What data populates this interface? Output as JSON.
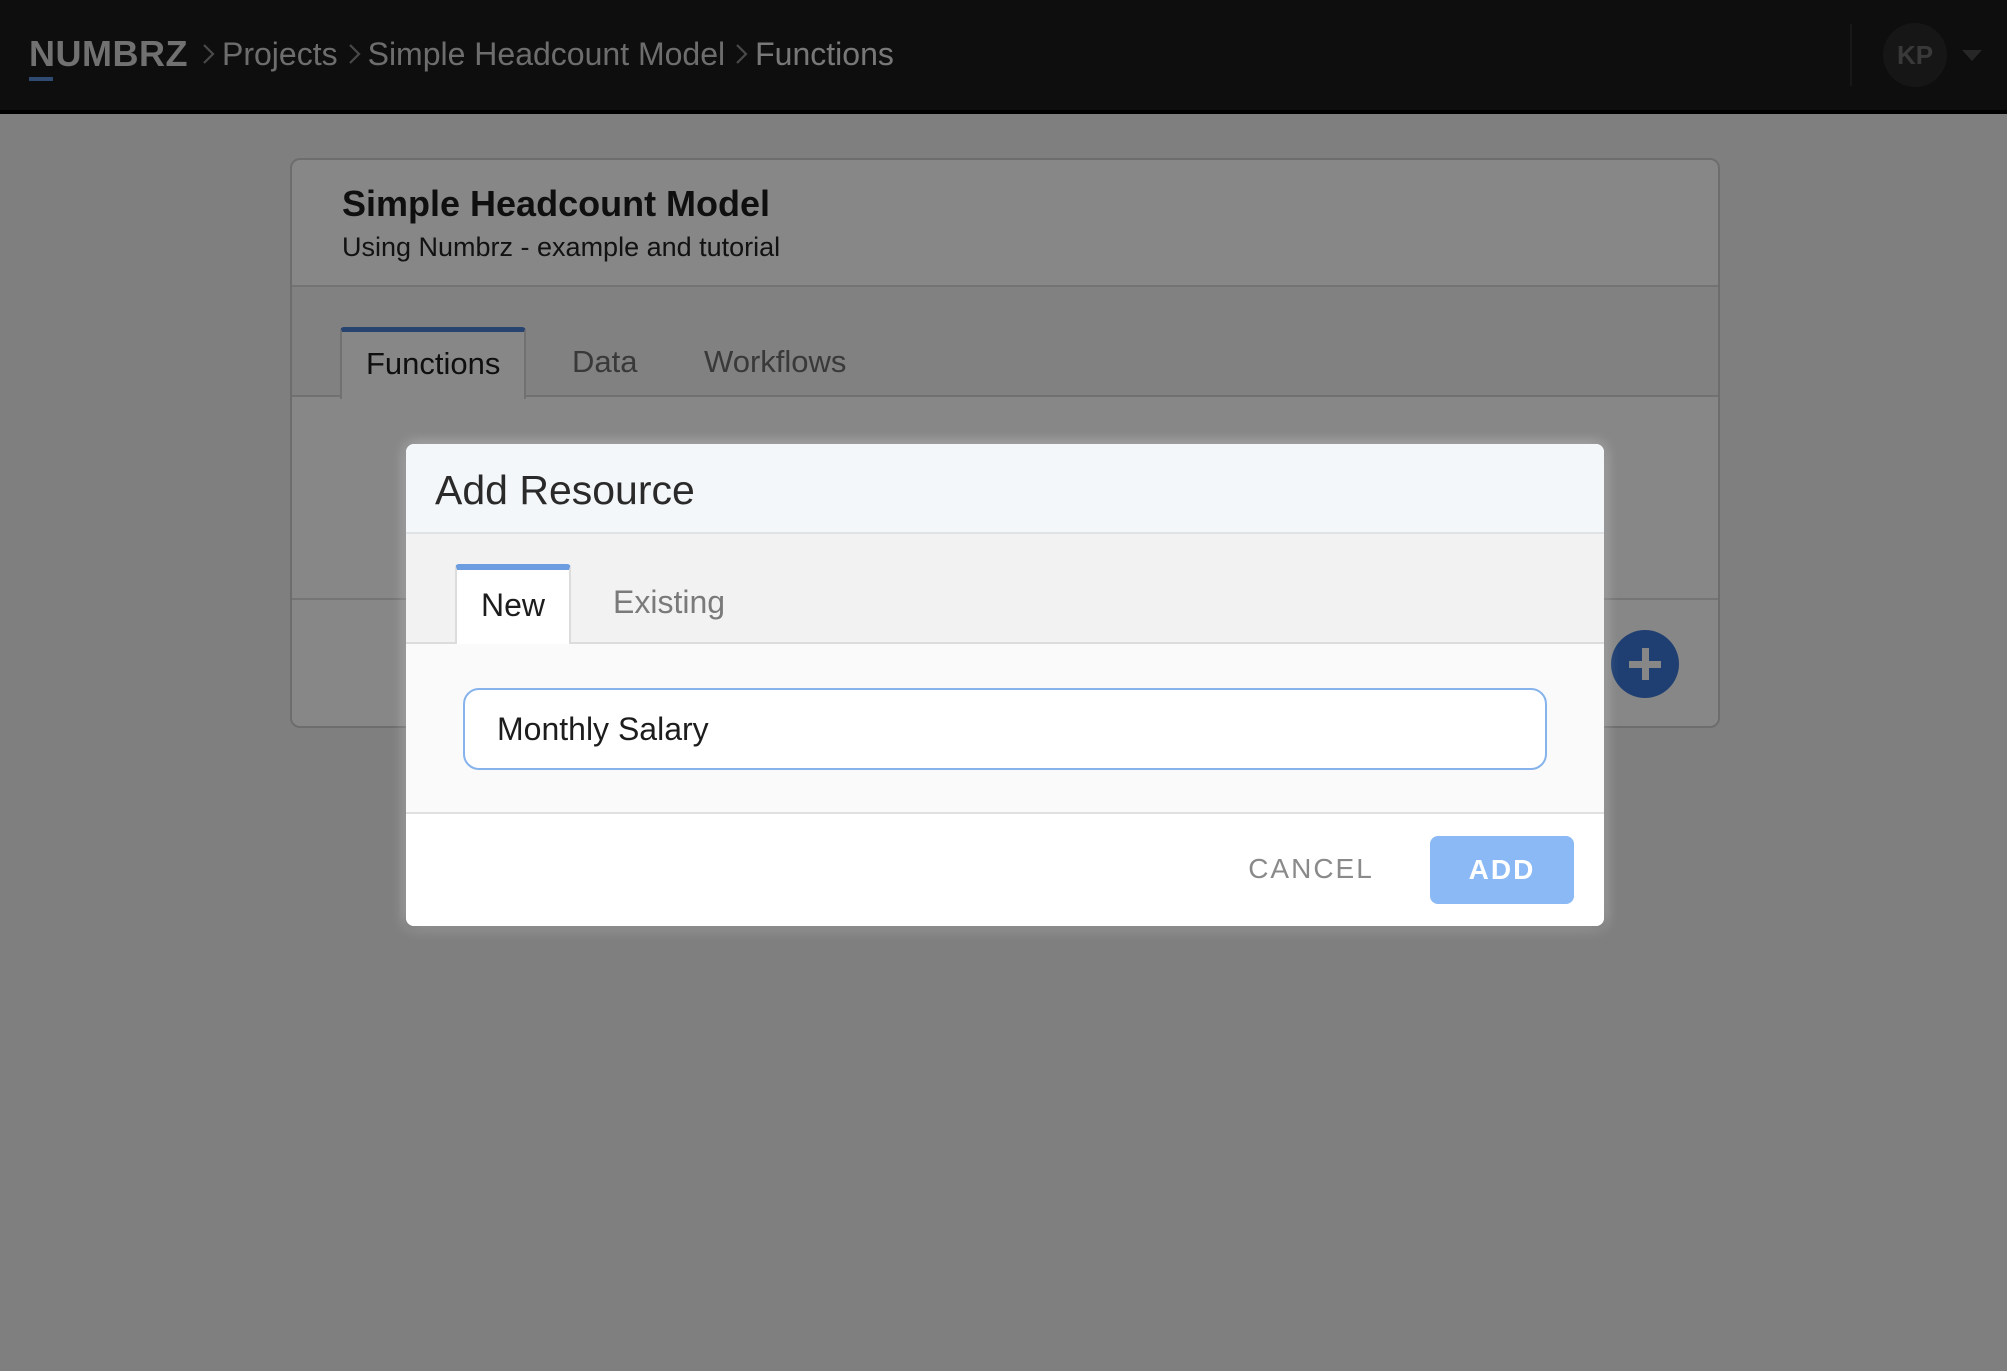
{
  "app": {
    "brand": "NUMBRZ",
    "brand_accent_color": "#5b8fd6"
  },
  "breadcrumb": [
    {
      "label": "Projects"
    },
    {
      "label": "Simple Headcount Model"
    },
    {
      "label": "Functions"
    }
  ],
  "user": {
    "initials": "KP"
  },
  "project": {
    "title": "Simple Headcount Model",
    "subtitle": "Using Numbrz - example and tutorial",
    "tabs": [
      {
        "label": "Functions",
        "active": true
      },
      {
        "label": "Data",
        "active": false
      },
      {
        "label": "Workflows",
        "active": false
      }
    ],
    "add_button_icon": "plus-icon",
    "accent_color": "#3b78d8"
  },
  "modal": {
    "title": "Add Resource",
    "tabs": [
      {
        "label": "New",
        "active": true
      },
      {
        "label": "Existing",
        "active": false
      }
    ],
    "name_input_value": "Monthly Salary",
    "cancel_label": "CANCEL",
    "add_label": "ADD",
    "add_button_color": "#8ab9f5"
  }
}
